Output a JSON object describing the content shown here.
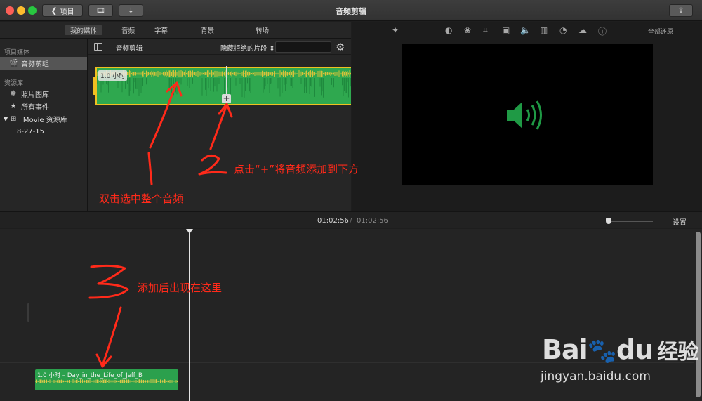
{
  "titlebar": {
    "back_label": "项目",
    "title": "音频剪辑"
  },
  "tabs": [
    "我的媒体",
    "音频",
    "字幕",
    "背景",
    "转场"
  ],
  "sidebar": {
    "section_project": "项目媒体",
    "project_item": "音频剪辑",
    "section_library": "资源库",
    "items": [
      "照片图库",
      "所有事件",
      "iMovie 资源库",
      "8-27-15"
    ]
  },
  "browser": {
    "title": "音频剪辑",
    "filter": "隐藏拒绝的片段",
    "search_placeholder": "",
    "clip_duration": "1.0 小时"
  },
  "viewer": {
    "restore_all": "全部还原",
    "tools": [
      "magic-wand-icon",
      "color-balance-icon",
      "color-correction-icon",
      "crop-icon",
      "stabilization-icon",
      "volume-icon",
      "equalizer-icon",
      "speed-icon",
      "filter-icon",
      "info-icon"
    ]
  },
  "timeline": {
    "current_time": "01:02:56",
    "separator": "/",
    "total_time": "01:02:56",
    "settings_label": "设置",
    "clip_label": "1.0 小时 – Day_in_the_Life_of_Jeff_B"
  },
  "annotations": {
    "a1": "双击选中整个音频",
    "a2": "点击“+”将音频添加到下方",
    "a3": "添加后出现在这里"
  },
  "watermark": {
    "brand": "Bai",
    "brand2": "du",
    "cn": "经验",
    "url": "jingyan.baidu.com"
  },
  "colors": {
    "accent_green": "#2fa84f",
    "selection_yellow": "#f0c020",
    "annotation_red": "#ff2a1a",
    "speaker_green": "#1f9a45"
  }
}
